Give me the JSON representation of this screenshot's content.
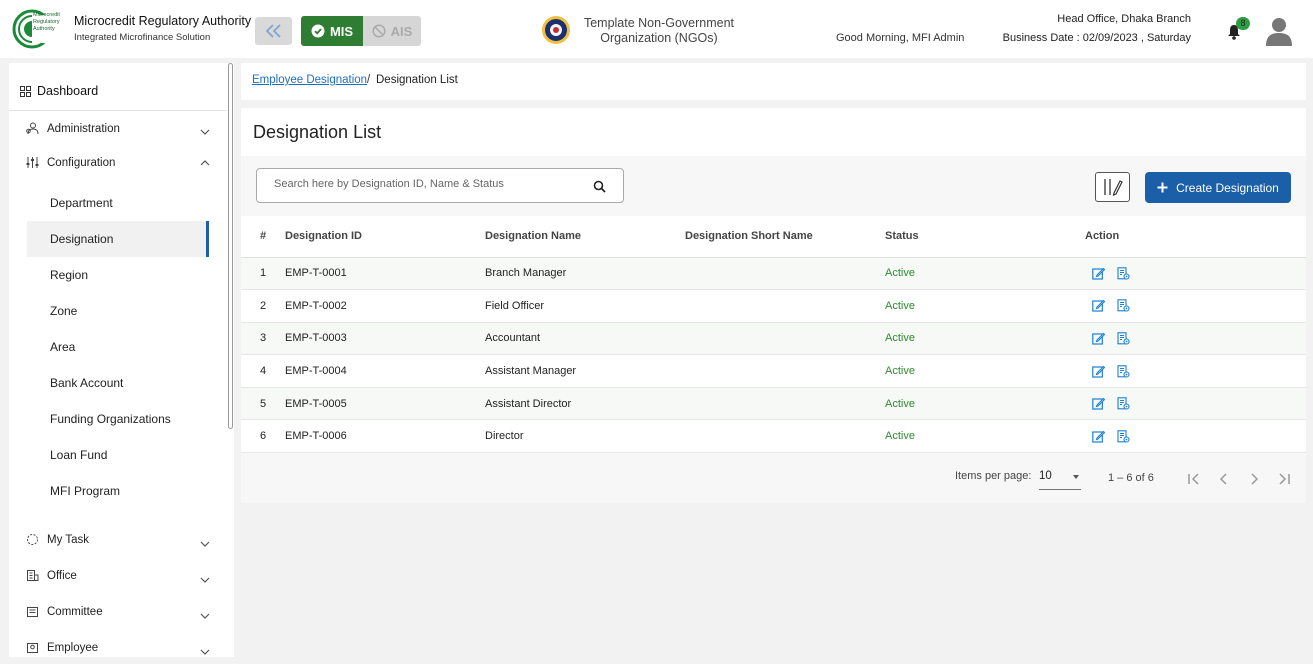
{
  "header": {
    "brand_title": "Microcredit Regulatory Authority",
    "brand_subtitle": "Integrated Microfinance Solution",
    "logo_text": "Microcredit Regulatory Authority",
    "mode_mis": "MIS",
    "mode_ais": "AIS",
    "org_name": "Template Non-Government Organization (NGOs)",
    "greeting": "Good Morning, MFI Admin",
    "branch": "Head Office, Dhaka Branch",
    "business_date": "Business Date : 02/09/2023 , Saturday",
    "notification_count": "8"
  },
  "sidebar": {
    "dashboard": "Dashboard",
    "administration": "Administration",
    "configuration": "Configuration",
    "config_items": [
      "Department",
      "Designation",
      "Region",
      "Zone",
      "Area",
      "Bank Account",
      "Funding Organizations",
      "Loan Fund",
      "MFI Program"
    ],
    "active_item": "Designation",
    "my_task": "My Task",
    "office": "Office",
    "committee": "Committee",
    "employee": "Employee"
  },
  "breadcrumb": {
    "parent": "Employee Designation",
    "separator": "/",
    "current": "Designation List"
  },
  "page": {
    "title": "Designation List",
    "search_placeholder": "Search here by Designation ID, Name & Status",
    "create_button": "Create Designation"
  },
  "table": {
    "headers": [
      "#",
      "Designation ID",
      "Designation Name",
      "Designation Short Name",
      "Status",
      "Action"
    ],
    "rows": [
      {
        "num": "1",
        "id": "EMP-T-0001",
        "name": "Branch Manager",
        "short": "",
        "status": "Active"
      },
      {
        "num": "2",
        "id": "EMP-T-0002",
        "name": "Field Officer",
        "short": "",
        "status": "Active"
      },
      {
        "num": "3",
        "id": "EMP-T-0003",
        "name": "Accountant",
        "short": "",
        "status": "Active"
      },
      {
        "num": "4",
        "id": "EMP-T-0004",
        "name": "Assistant Manager",
        "short": "",
        "status": "Active"
      },
      {
        "num": "5",
        "id": "EMP-T-0005",
        "name": "Assistant Director",
        "short": "",
        "status": "Active"
      },
      {
        "num": "6",
        "id": "EMP-T-0006",
        "name": "Director",
        "short": "",
        "status": "Active"
      }
    ]
  },
  "pagination": {
    "items_per_page_label": "Items per page:",
    "items_per_page": "10",
    "range": "1 – 6 of 6"
  },
  "colors": {
    "primary": "#1a5fa8",
    "mis_active": "#2e7d32",
    "status_active": "#2e8b2e",
    "link": "#1e6fbf"
  }
}
